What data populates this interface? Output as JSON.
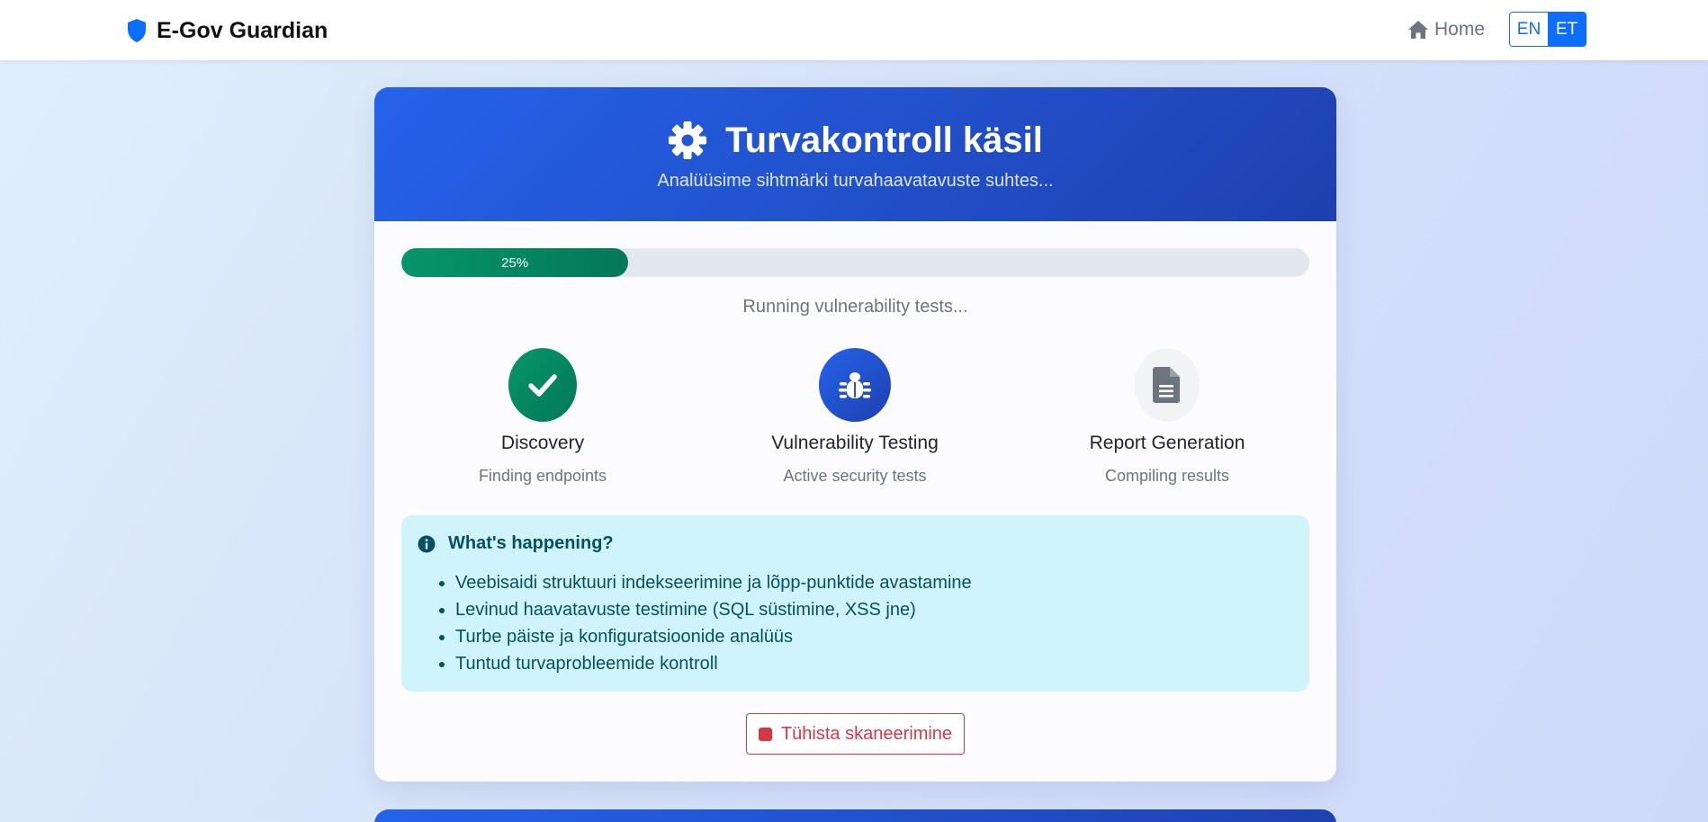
{
  "navbar": {
    "brand": "E-Gov Guardian",
    "home_label": "Home",
    "languages": [
      "EN",
      "ET"
    ],
    "active_language": "ET"
  },
  "scan": {
    "title": "Turvakontroll käsil",
    "subtitle": "Analüüsime sihtmärki turvahaavatavuste suhtes...",
    "progress": 25,
    "progress_label": "25%",
    "status": "Running vulnerability tests...",
    "steps": [
      {
        "title": "Discovery",
        "desc": "Finding endpoints",
        "state": "done",
        "icon": "check-icon"
      },
      {
        "title": "Vulnerability Testing",
        "desc": "Active security tests",
        "state": "active",
        "icon": "bug-icon"
      },
      {
        "title": "Report Generation",
        "desc": "Compiling results",
        "state": "pending",
        "icon": "file-icon"
      }
    ],
    "info": {
      "heading": "What's happening?",
      "items": [
        "Veebisaidi struktuuri indekseerimine ja lõpp-punktide avastamine",
        "Levinud haavatavuste testimine (SQL süstimine, XSS jne)",
        "Turbe päiste ja konfiguratsioonide analüüs",
        "Tuntud turvaprobleemide kontroll"
      ]
    },
    "cancel_label": "Tühista skaneerimine"
  },
  "colors": {
    "primary": "#2563eb",
    "success": "#059669",
    "danger": "#dc3545",
    "info_bg": "#cff4fc"
  }
}
